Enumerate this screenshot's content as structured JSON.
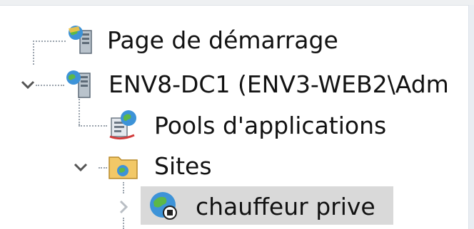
{
  "tree": {
    "items": [
      {
        "label": "Page de démarrage",
        "icon": "start-page-icon"
      },
      {
        "label": "ENV8-DC1 (ENV3-WEB2\\Adm",
        "icon": "server-icon",
        "expanded": true
      },
      {
        "label": "Pools d'applications",
        "icon": "app-pools-icon"
      },
      {
        "label": "Sites",
        "icon": "sites-folder-icon",
        "expanded": true
      },
      {
        "label": "chauffeur prive",
        "icon": "website-globe-icon",
        "selected": true,
        "expanded": false
      }
    ]
  },
  "colors": {
    "selection": "#d9d9d9",
    "tree_lines": "#9aa3ad",
    "text": "#121212"
  }
}
